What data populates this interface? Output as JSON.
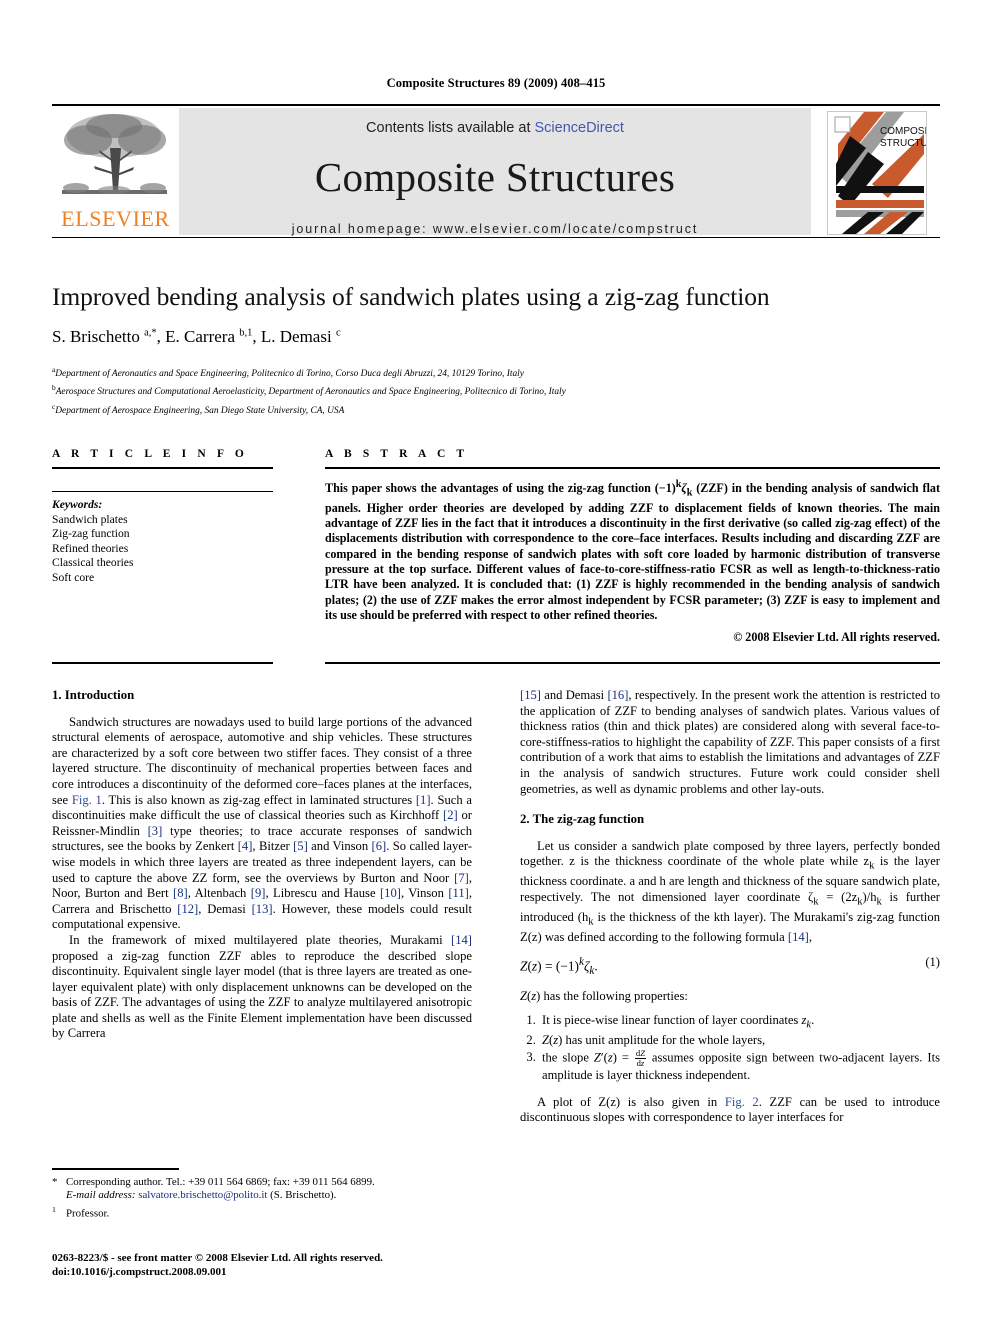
{
  "running_head": "Composite Structures 89 (2009) 408–415",
  "masthead": {
    "contents_prefix": "Contents lists available at ",
    "sciencedirect": "ScienceDirect",
    "journal_name": "Composite Structures",
    "homepage": "journal homepage: www.elsevier.com/locate/compstruct",
    "publisher_word": "ELSEVIER",
    "cover_title_line1": "COMPOSITE",
    "cover_title_line2": "STRUCTURES",
    "colors": {
      "elsevier_orange": "#F08122",
      "link_blue": "#4656ad",
      "band_grey": "#e4e4e4",
      "cover_orange": "#C85A2E",
      "cover_grey": "#9d9d9d",
      "cover_black": "#111111"
    }
  },
  "article": {
    "title": "Improved bending analysis of sandwich plates using a zig-zag function",
    "authors_html": "S. Brischetto <sup>a,*</sup>, E. Carrera <sup>b,1</sup>, L. Demasi <sup>c</sup>",
    "affiliations": [
      {
        "mark": "a",
        "text": "Department of Aeronautics and Space Engineering, Politecnico di Torino, Corso Duca degli Abruzzi, 24, 10129 Torino, Italy"
      },
      {
        "mark": "b",
        "text": "Aerospace Structures and Computational Aeroelasticity, Department of Aeronautics and Space Engineering, Politecnico di Torino, Italy"
      },
      {
        "mark": "c",
        "text": "Department of Aerospace Engineering, San Diego State University, CA, USA"
      }
    ]
  },
  "article_info": {
    "heading": "A R T I C L E  I N F O",
    "keywords_title": "Keywords:",
    "keywords": [
      "Sandwich plates",
      "Zig-zag function",
      "Refined theories",
      "Classical theories",
      "Soft core"
    ]
  },
  "abstract": {
    "heading": "A B S T R A C T",
    "text": "This paper shows the advantages of using the zig-zag function (−1)kζk (ZZF) in the bending analysis of sandwich flat panels. Higher order theories are developed by adding ZZF to displacement fields of known theories. The main advantage of ZZF lies in the fact that it introduces a discontinuity in the first derivative (so called zig-zag effect) of the displacements distribution with correspondence to the core–face interfaces. Results including and discarding ZZF are compared in the bending response of sandwich plates with soft core loaded by harmonic distribution of transverse pressure at the top surface. Different values of face-to-core-stiffness-ratio FCSR as well as length-to-thickness-ratio LTR have been analyzed. It is concluded that: (1) ZZF is highly recommended in the bending analysis of sandwich plates; (2) the use of ZZF makes the error almost independent by FCSR parameter; (3) ZZF is easy to implement and its use should be preferred with respect to other refined theories.",
    "copyright": "© 2008 Elsevier Ltd. All rights reserved."
  },
  "body": {
    "intro_heading": "1. Introduction",
    "intro_p1_a": "Sandwich structures are nowadays used to build large portions of the advanced structural elements of aerospace, automotive and ship vehicles. These structures are characterized by a soft core between two stiffer faces. They consist of a three layered structure. The discontinuity of mechanical properties between faces and core introduces a discontinuity of the deformed core–faces planes at the interfaces, see ",
    "intro_fig1": "Fig. 1",
    "intro_p1_b": ". This is also known as zig-zag effect in laminated structures ",
    "ref1": "[1]",
    "intro_p1_c": ". Such a discontinuities make difficult the use of classical theories such as Kirchhoff ",
    "ref2": "[2]",
    "intro_p1_d": " or Reissner-Mindlin ",
    "ref3": "[3]",
    "intro_p1_e": " type theories; to trace accurate responses of sandwich structures, see the books by Zenkert ",
    "ref4": "[4]",
    "intro_p1_f": ", Bitzer ",
    "ref5": "[5]",
    "intro_p1_g": " and Vinson ",
    "ref6": "[6]",
    "intro_p1_h": ". So called layer-wise models in which three layers are treated as three independent layers, can be used to capture the above ZZ form, see the overviews by Burton and Noor ",
    "ref7": "[7]",
    "intro_p1_i": ", Noor, Burton and Bert ",
    "ref8": "[8]",
    "intro_p1_j": ", Altenbach ",
    "ref9": "[9]",
    "intro_p1_k": ", Librescu and Hause ",
    "ref10": "[10]",
    "intro_p1_l": ", Vinson ",
    "ref11": "[11]",
    "intro_p1_m": ", Carrera and Brischetto ",
    "ref12": "[12]",
    "intro_p1_n": ", Demasi ",
    "ref13": "[13]",
    "intro_p1_o": ". However, these models could result computational expensive.",
    "intro_p2_a": "In the framework of mixed multilayered plate theories, Murakami ",
    "ref14a": "[14]",
    "intro_p2_b": " proposed a zig-zag function ZZF ables to reproduce the described slope discontinuity. Equivalent single layer model (that is three layers are treated as one-layer equivalent plate) with only displacement unknowns can be developed on the basis of ZZF. The advantages of using the ZZF to analyze multilayered anisotropic plate and shells as well as the Finite Element implementation have been discussed by Carrera ",
    "ref15": "[15]",
    "intro_p2_c": " and Demasi ",
    "ref16": "[16]",
    "intro_p2_d": ", respectively. In the present work the attention is restricted to the application of ZZF to bending analyses of sandwich plates. Various values of thickness ratios (thin and thick plates) are considered along with several face-to-core-stiffness-ratios to highlight the capability of ZZF. This paper consists of a first contribution of a work that aims to establish the limitations and advantages of ZZF in the analysis of sandwich structures. Future work could consider shell geometries, as well as dynamic problems and other lay-outs.",
    "zigzag_heading": "2. The zig-zag function",
    "zigzag_p1_a": "Let us consider a sandwich plate composed by three layers, perfectly bonded together. z is the thickness coordinate of the whole plate while z",
    "zigzag_p1_b": " is the layer thickness coordinate. a and h are length and thickness of the square sandwich plate, respectively. The not dimensioned layer coordinate ζ",
    "zigzag_p1_c": " = (2z",
    "zigzag_p1_d": ")/h",
    "zigzag_p1_e": " is further introduced (h",
    "zigzag_p1_f": " is the thickness of the kth layer). The Murakami's zig-zag function Z(z) was defined according to the following formula ",
    "ref14b": "[14]",
    "zigzag_p1_g": ",",
    "equation": "Z(z) = (−1)kζk.",
    "equation_number": "(1)",
    "properties_intro": "Z(z) has the following properties:",
    "properties": [
      "It is piece-wise linear function of layer coordinates zk.",
      "Z(z) has unit amplitude for the whole layers,",
      "the slope Z′(z) = dZ/dz assumes opposite sign between two-adjacent layers. Its amplitude is layer thickness independent."
    ],
    "closing_a": "A plot of Z(z) is also given in ",
    "fig2": "Fig. 2",
    "closing_b": ". ZZF can be used to introduce discontinuous slopes with correspondence to layer interfaces for"
  },
  "footnotes": {
    "corresponding": "Corresponding author. Tel.: +39 011 564 6869; fax: +39 011 564 6899.",
    "email_label": "E-mail address:",
    "email": "salvatore.brischetto@polito.it",
    "email_owner": "(S. Brischetto).",
    "professor": "Professor.",
    "issn_line": "0263-8223/$ - see front matter © 2008 Elsevier Ltd. All rights reserved.",
    "doi_line": "doi:10.1016/j.compstruct.2008.09.001"
  }
}
